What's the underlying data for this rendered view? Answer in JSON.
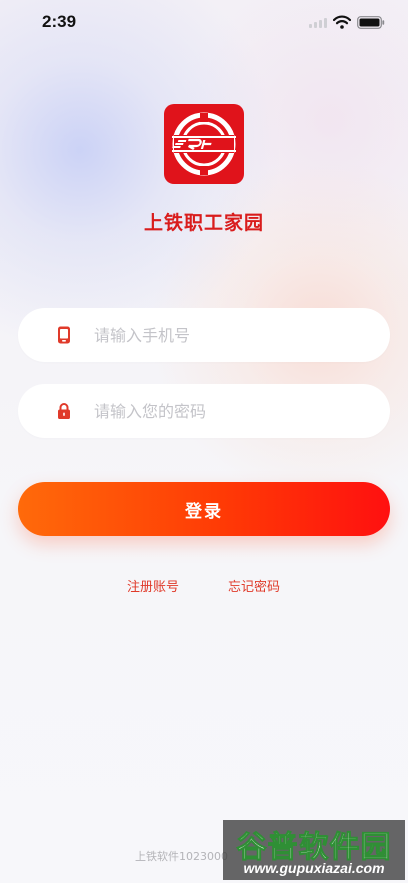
{
  "status_bar": {
    "time": "2:39",
    "icons": [
      "signal-icon",
      "wifi-icon",
      "battery-icon"
    ]
  },
  "app": {
    "logo_icon": "sr-logo-icon",
    "name": "上铁职工家园",
    "brand_color": "#e0131b"
  },
  "login_form": {
    "phone": {
      "icon": "phone-icon",
      "value": "",
      "placeholder": "请输入手机号"
    },
    "password": {
      "icon": "lock-icon",
      "value": "",
      "placeholder": "请输入您的密码"
    },
    "submit_label": "登录",
    "button_gradient": [
      "#ff6a0a",
      "#ff1010"
    ]
  },
  "links": {
    "register": "注册账号",
    "forgot_password": "忘记密码"
  },
  "footer": {
    "text": "上铁软件1023000"
  },
  "watermark": {
    "title": "谷普软件园",
    "url": "www.gupuxiazai.com"
  }
}
